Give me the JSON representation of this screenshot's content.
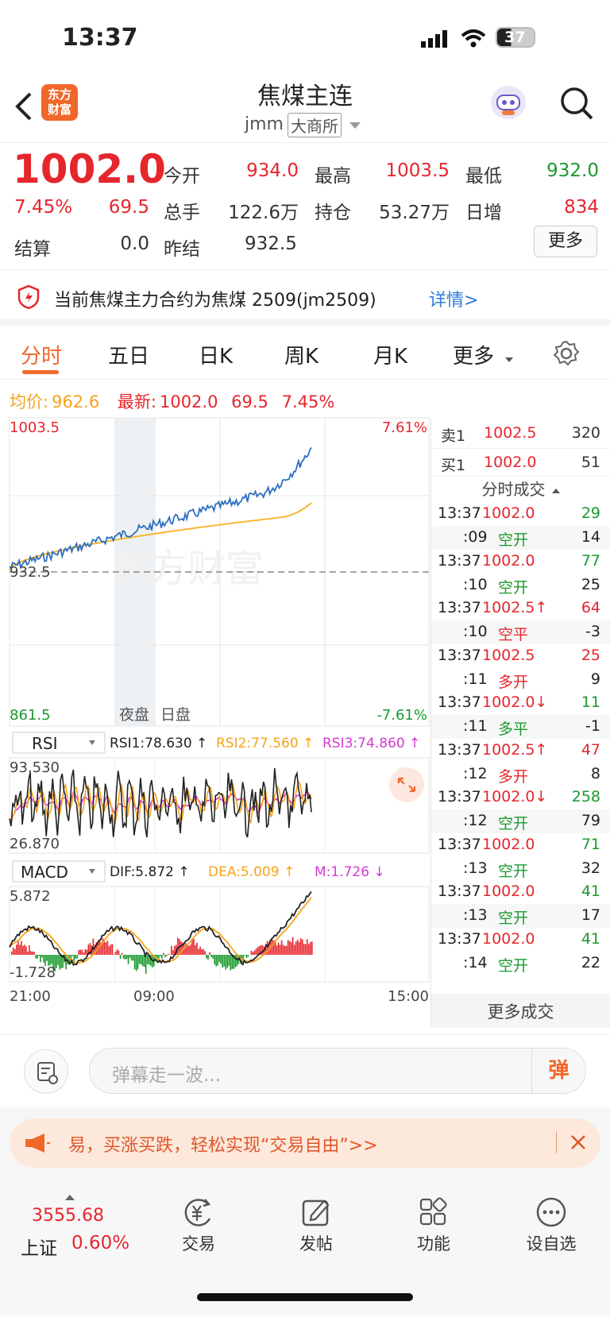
{
  "status": {
    "time": "13:37",
    "battery": "37"
  },
  "header": {
    "title": "焦煤主连",
    "code": "jmm",
    "exchange": "大商所",
    "logo_line1": "东方",
    "logo_line2": "财富"
  },
  "quote": {
    "price": "1002.0",
    "pct": "7.45%",
    "chg": "69.5",
    "open_label": "今开",
    "open": "934.0",
    "high_label": "最高",
    "high": "1003.5",
    "low_label": "最低",
    "low": "932.0",
    "vol_label": "总手",
    "vol": "122.6万",
    "oi_label": "持仓",
    "oi": "53.27万",
    "inc_label": "日增",
    "inc": "834",
    "settle_label": "结算",
    "settle": "0.0",
    "presettle_label": "昨结",
    "presettle": "932.5",
    "more": "更多"
  },
  "notice": {
    "text": "当前焦煤主力合约为焦煤 2509(jm2509)",
    "link": "详情>"
  },
  "tabs": [
    {
      "label": "分时"
    },
    {
      "label": "五日"
    },
    {
      "label": "日K"
    },
    {
      "label": "周K"
    },
    {
      "label": "月K"
    },
    {
      "label": "更多"
    }
  ],
  "infobar": {
    "avg_label": "均价:",
    "avg": "962.6",
    "last_label": "最新:",
    "last": "1002.0",
    "chg": "69.5",
    "pct": "7.45%"
  },
  "chart": {
    "ymax": "1003.5",
    "ymid": "932.5",
    "ymin": "861.5",
    "pmax": "7.61%",
    "pmin": "-7.61%",
    "night_label": "夜盘",
    "day_label": "日盘",
    "x_ticks": [
      "21:00",
      "09:00",
      "15:00"
    ],
    "watermark": "东方财富"
  },
  "rsi": {
    "name": "RSI",
    "rsi1": "RSI1:78.630 ↑",
    "rsi2": "RSI2:77.560 ↑",
    "rsi3": "RSI3:74.860 ↑",
    "max": "93.530",
    "min": "26.870"
  },
  "macd": {
    "name": "MACD",
    "dif": "DIF:5.872 ↑",
    "dea": "DEA:5.009 ↑",
    "m": "M:1.726 ↓",
    "max": "5.872",
    "min": "-1.728"
  },
  "orderbook": {
    "sell_label": "卖1",
    "sell_price": "1002.5",
    "sell_vol": "320",
    "buy_label": "买1",
    "buy_price": "1002.0",
    "buy_vol": "51"
  },
  "ticks_title": "分时成交",
  "ticks": [
    {
      "t": "13:37",
      "p": "1002.0",
      "v": "29",
      "s": ":09",
      "type": "空开",
      "n": "14",
      "pc": "red",
      "vc": "green",
      "tc": "green"
    },
    {
      "t": "13:37",
      "p": "1002.0",
      "v": "77",
      "s": ":10",
      "type": "空开",
      "n": "25",
      "pc": "red",
      "vc": "green",
      "tc": "green"
    },
    {
      "t": "13:37",
      "p": "1002.5↑",
      "v": "64",
      "s": ":10",
      "type": "空平",
      "n": "-3",
      "pc": "red",
      "vc": "red",
      "tc": "red"
    },
    {
      "t": "13:37",
      "p": "1002.5",
      "v": "25",
      "s": ":11",
      "type": "多开",
      "n": "9",
      "pc": "red",
      "vc": "red",
      "tc": "red"
    },
    {
      "t": "13:37",
      "p": "1002.0↓",
      "v": "11",
      "s": ":11",
      "type": "多平",
      "n": "-1",
      "pc": "red",
      "vc": "green",
      "tc": "green"
    },
    {
      "t": "13:37",
      "p": "1002.5↑",
      "v": "47",
      "s": ":12",
      "type": "多开",
      "n": "8",
      "pc": "red",
      "vc": "red",
      "tc": "red"
    },
    {
      "t": "13:37",
      "p": "1002.0↓",
      "v": "258",
      "s": ":12",
      "type": "空开",
      "n": "79",
      "pc": "red",
      "vc": "green",
      "tc": "green"
    },
    {
      "t": "13:37",
      "p": "1002.0",
      "v": "71",
      "s": ":13",
      "type": "空开",
      "n": "32",
      "pc": "red",
      "vc": "green",
      "tc": "green"
    },
    {
      "t": "13:37",
      "p": "1002.0",
      "v": "41",
      "s": ":13",
      "type": "空开",
      "n": "17",
      "pc": "red",
      "vc": "green",
      "tc": "green"
    },
    {
      "t": "13:37",
      "p": "1002.0",
      "v": "41",
      "s": ":14",
      "type": "空开",
      "n": "22",
      "pc": "red",
      "vc": "green",
      "tc": "green"
    }
  ],
  "more_ticks": "更多成交",
  "danmu": {
    "placeholder": "弹幕走一波...",
    "send": "弹"
  },
  "ad": {
    "text": "易，买涨买跌，轻松实现“交易自由”>>"
  },
  "bottom": {
    "index_value": "3555.68",
    "index_name": "上证",
    "index_pct": "0.60%",
    "items": [
      {
        "label": "交易"
      },
      {
        "label": "发帖"
      },
      {
        "label": "功能"
      },
      {
        "label": "设自选"
      }
    ]
  },
  "colors": {
    "up": "#e5262d",
    "down": "#1a9a2e",
    "price_line": "#2f6fbf",
    "avg_line": "#f7b731",
    "accent": "#f0672a"
  }
}
